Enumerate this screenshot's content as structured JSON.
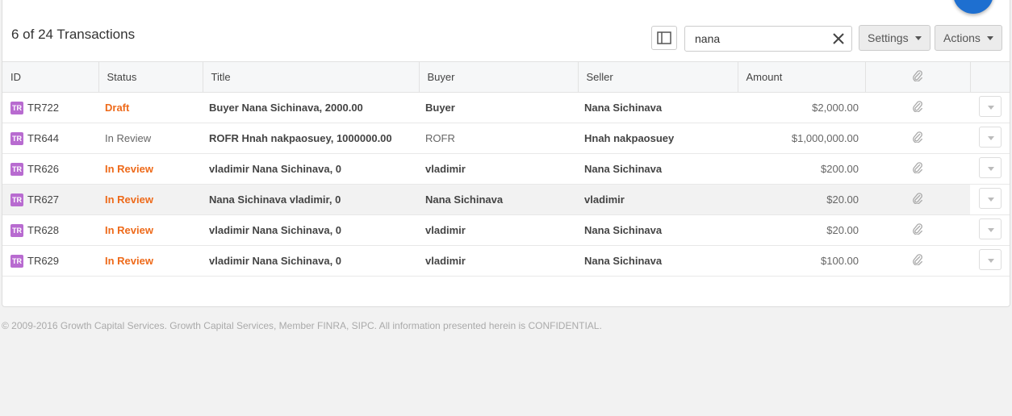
{
  "header": {
    "title": "6 of 24 Transactions",
    "search_value": "nana",
    "settings_label": "Settings",
    "actions_label": "Actions"
  },
  "table": {
    "columns": [
      "ID",
      "Status",
      "Title",
      "Buyer",
      "Seller",
      "Amount"
    ],
    "badge": "TR",
    "rows": [
      {
        "id": "TR722",
        "status": "Draft",
        "status_style": "orange",
        "title": "Buyer Nana Sichinava, 2000.00",
        "buyer": "Buyer",
        "buyer_style": "bold",
        "seller": "Nana Sichinava",
        "amount": "$2,000.00"
      },
      {
        "id": "TR644",
        "status": "In Review",
        "status_style": "gray",
        "title": "ROFR Hnah nakpaosuey, 1000000.00",
        "buyer": "ROFR",
        "buyer_style": "gray",
        "seller": "Hnah nakpaosuey",
        "amount": "$1,000,000.00"
      },
      {
        "id": "TR626",
        "status": "In Review",
        "status_style": "orange",
        "title": "vladimir Nana Sichinava, 0",
        "buyer": "vladimir",
        "buyer_style": "bold",
        "seller": "Nana Sichinava",
        "amount": "$200.00"
      },
      {
        "id": "TR627",
        "status": "In Review",
        "status_style": "orange",
        "title": "Nana Sichinava vladimir, 0",
        "buyer": "Nana Sichinava",
        "buyer_style": "bold",
        "seller": "vladimir",
        "amount": "$20.00"
      },
      {
        "id": "TR628",
        "status": "In Review",
        "status_style": "orange",
        "title": "vladimir Nana Sichinava, 0",
        "buyer": "vladimir",
        "buyer_style": "bold",
        "seller": "Nana Sichinava",
        "amount": "$20.00"
      },
      {
        "id": "TR629",
        "status": "In Review",
        "status_style": "orange",
        "title": "vladimir Nana Sichinava, 0",
        "buyer": "vladimir",
        "buyer_style": "bold",
        "seller": "Nana Sichinava",
        "amount": "$100.00"
      }
    ]
  },
  "footer": {
    "text": "© 2009-2016 Growth Capital Services. Growth Capital Services, Member FINRA, SIPC. All information presented herein is CONFIDENTIAL."
  },
  "colors": {
    "accent_orange": "#ee6a1a",
    "badge_purple": "#b86bd0",
    "fab_blue": "#1e6fd0"
  }
}
